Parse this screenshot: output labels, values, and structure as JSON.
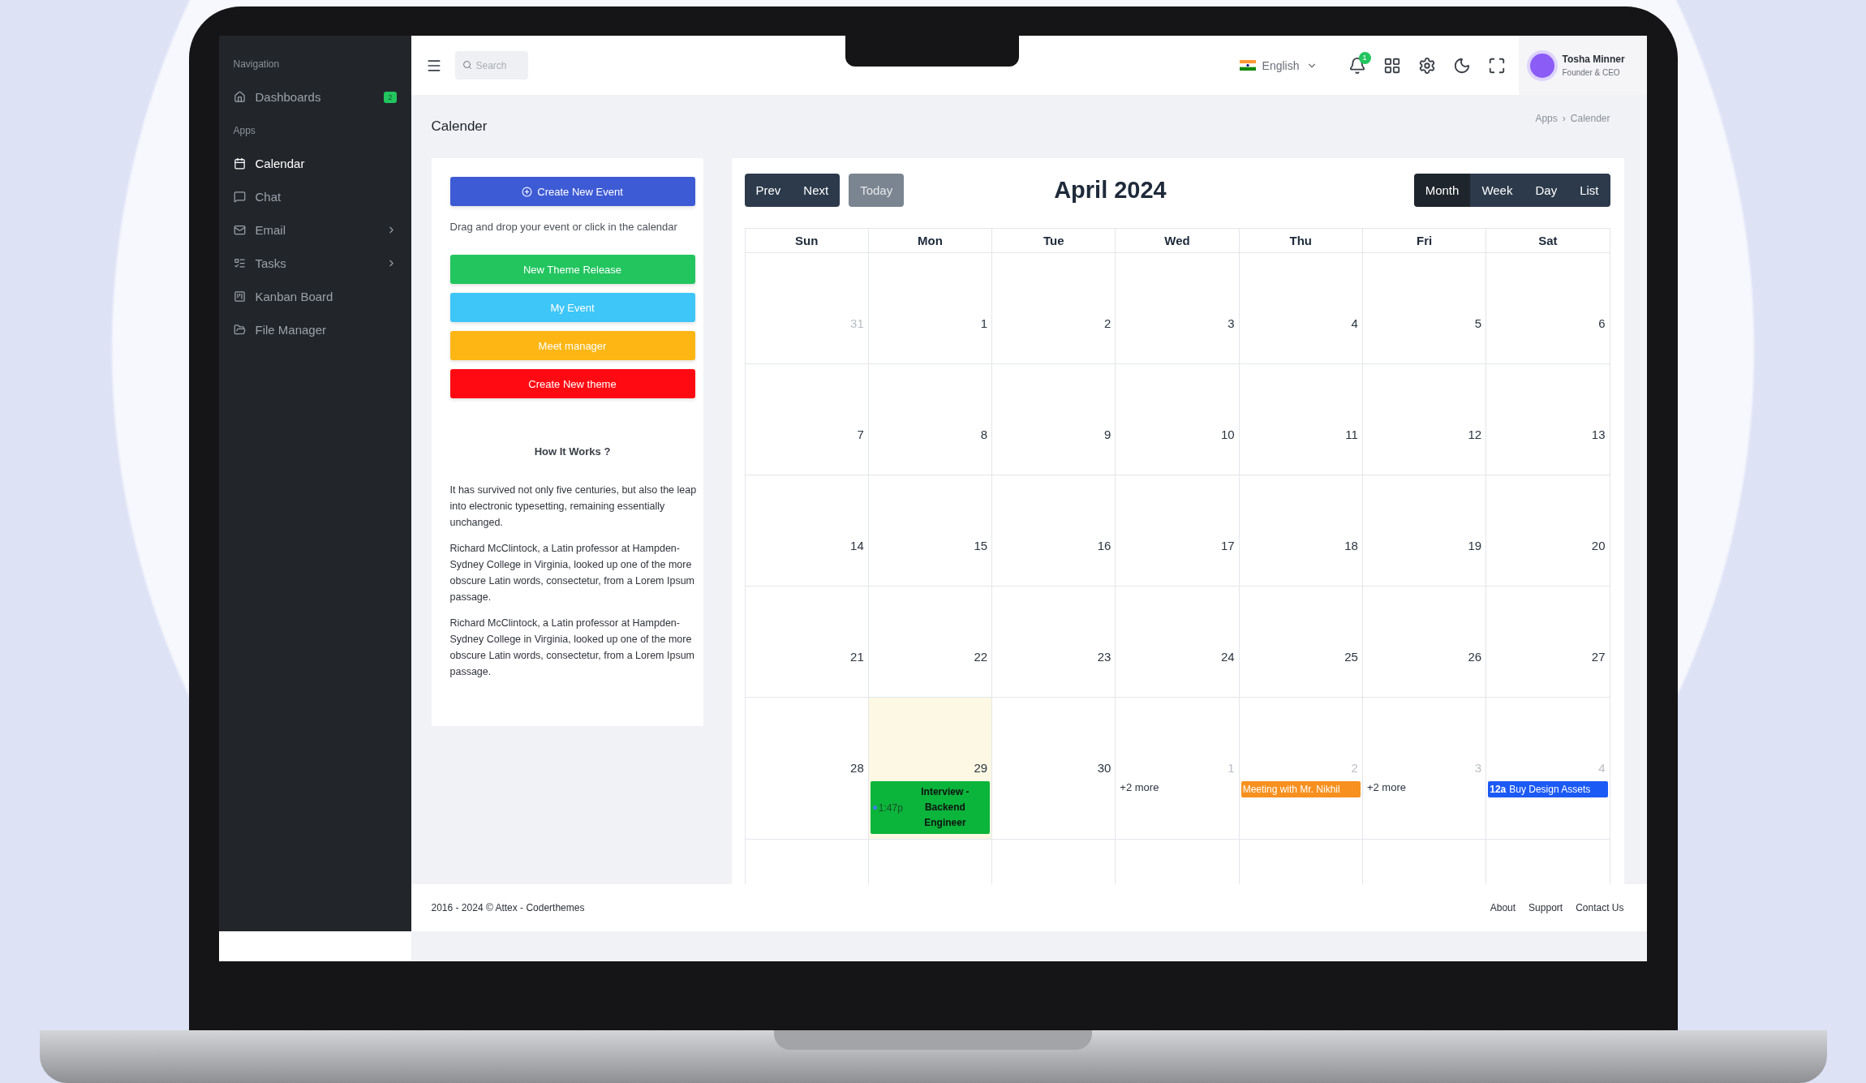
{
  "sidebar": {
    "sections": [
      {
        "title": "Navigation",
        "items": [
          {
            "label": "Dashboards",
            "kind": "home",
            "badge": "2",
            "selected": false,
            "has_submenu": false
          }
        ]
      },
      {
        "title": "Apps",
        "items": [
          {
            "label": "Calendar",
            "kind": "calendar",
            "selected": true,
            "has_submenu": false
          },
          {
            "label": "Chat",
            "kind": "chat",
            "selected": false,
            "has_submenu": false
          },
          {
            "label": "Email",
            "kind": "mail",
            "selected": false,
            "has_submenu": true
          },
          {
            "label": "Tasks",
            "kind": "tasks",
            "selected": false,
            "has_submenu": true
          },
          {
            "label": "Kanban Board",
            "kind": "kanban",
            "selected": false,
            "has_submenu": false
          },
          {
            "label": "File Manager",
            "kind": "folder",
            "selected": false,
            "has_submenu": false
          }
        ]
      }
    ]
  },
  "topbar": {
    "search": {
      "placeholder": "Search"
    },
    "language": "English",
    "notifications": "1",
    "user": {
      "name": "Tosha Minner",
      "role": "Founder & CEO"
    }
  },
  "page": {
    "title": "Calender",
    "breadcrumb": {
      "items": [
        "Apps",
        "Calender"
      ],
      "separator": "›"
    }
  },
  "events_panel": {
    "create_button": "Create New Event",
    "hint": "Drag and drop your event or click in the calendar",
    "events": [
      {
        "label": "New Theme Release",
        "color": "#22c55e"
      },
      {
        "label": "My Event",
        "color": "#3ec6f8"
      },
      {
        "label": "Meet manager",
        "color": "#fdb614"
      },
      {
        "label": "Create New theme",
        "color": "#ff0a12"
      }
    ],
    "how_title": "How It Works ?",
    "paragraphs": [
      "It has survived not only five centuries, but also the leap into electronic typesetting, remaining essentially unchanged.",
      "Richard McClintock, a Latin professor at Hampden-Sydney College in Virginia, looked up one of the more obscure Latin words, consectetur, from a Lorem Ipsum passage.",
      "Richard McClintock, a Latin professor at Hampden-Sydney College in Virginia, looked up one of the more obscure Latin words, consectetur, from a Lorem Ipsum passage."
    ]
  },
  "calendar": {
    "nav": [
      "Prev",
      "Next"
    ],
    "today": {
      "label": "Today",
      "disabled": true
    },
    "title": "April 2024",
    "views": [
      {
        "label": "Month",
        "selected": true
      },
      {
        "label": "Week",
        "selected": false
      },
      {
        "label": "Day",
        "selected": false
      },
      {
        "label": "List",
        "selected": false
      }
    ],
    "weekdays": [
      "Sun",
      "Mon",
      "Tue",
      "Wed",
      "Thu",
      "Fri",
      "Sat"
    ],
    "weeks": [
      [
        {
          "day": "31",
          "other_month": true,
          "today": false
        },
        {
          "day": "1",
          "other_month": false,
          "today": false
        },
        {
          "day": "2",
          "other_month": false,
          "today": false
        },
        {
          "day": "3",
          "other_month": false,
          "today": false
        },
        {
          "day": "4",
          "other_month": false,
          "today": false
        },
        {
          "day": "5",
          "other_month": false,
          "today": false
        },
        {
          "day": "6",
          "other_month": false,
          "today": false
        }
      ],
      [
        {
          "day": "7",
          "other_month": false,
          "today": false
        },
        {
          "day": "8",
          "other_month": false,
          "today": false
        },
        {
          "day": "9",
          "other_month": false,
          "today": false
        },
        {
          "day": "10",
          "other_month": false,
          "today": false
        },
        {
          "day": "11",
          "other_month": false,
          "today": false
        },
        {
          "day": "12",
          "other_month": false,
          "today": false
        },
        {
          "day": "13",
          "other_month": false,
          "today": false
        }
      ],
      [
        {
          "day": "14",
          "other_month": false,
          "today": false
        },
        {
          "day": "15",
          "other_month": false,
          "today": false
        },
        {
          "day": "16",
          "other_month": false,
          "today": false
        },
        {
          "day": "17",
          "other_month": false,
          "today": false
        },
        {
          "day": "18",
          "other_month": false,
          "today": false
        },
        {
          "day": "19",
          "other_month": false,
          "today": false
        },
        {
          "day": "20",
          "other_month": false,
          "today": false
        }
      ],
      [
        {
          "day": "21",
          "other_month": false,
          "today": false
        },
        {
          "day": "22",
          "other_month": false,
          "today": false
        },
        {
          "day": "23",
          "other_month": false,
          "today": false
        },
        {
          "day": "24",
          "other_month": false,
          "today": false
        },
        {
          "day": "25",
          "other_month": false,
          "today": false
        },
        {
          "day": "26",
          "other_month": false,
          "today": false
        },
        {
          "day": "27",
          "other_month": false,
          "today": false
        }
      ],
      [
        {
          "day": "28",
          "other_month": false,
          "today": false
        },
        {
          "day": "29",
          "other_month": false,
          "today": true,
          "events": [
            {
              "kind": "dot",
              "time": "1:47p",
              "title": "Interview - Backend Engineer",
              "color": "#0bb43a"
            }
          ]
        },
        {
          "day": "30",
          "other_month": false,
          "today": false
        },
        {
          "day": "1",
          "other_month": true,
          "today": false,
          "more": "+2 more"
        },
        {
          "day": "2",
          "other_month": true,
          "today": false,
          "events": [
            {
              "kind": "block",
              "title": "Meeting with Mr. Nikhil",
              "color": "#f7901e"
            }
          ]
        },
        {
          "day": "3",
          "other_month": true,
          "today": false,
          "more": "+2 more"
        },
        {
          "day": "4",
          "other_month": true,
          "today": false,
          "events": [
            {
              "kind": "block",
              "time": "12a",
              "title": "Buy Design Assets",
              "color": "#1c5af5"
            }
          ]
        }
      ]
    ]
  },
  "footer": {
    "copyright": "2016 - 2024 © Attex - Coderthemes",
    "links": [
      "About",
      "Support",
      "Contact Us"
    ]
  }
}
